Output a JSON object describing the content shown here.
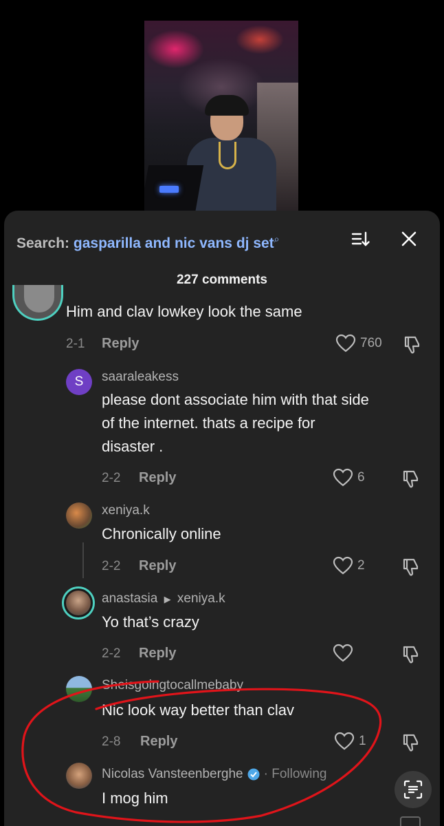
{
  "search": {
    "prefix": "Search:",
    "query": "gasparilla and nic vans dj set"
  },
  "comments_count": "227 comments",
  "comments": [
    {
      "text": "Him and clav lowkey look the same",
      "date": "2-1",
      "reply": "Reply",
      "likes": "760"
    },
    {
      "username": "saaraleakess",
      "avatar_letter": "S",
      "text_lines": [
        "please dont associate him with that side",
        "of the internet. thats a recipe for",
        "disaster ."
      ],
      "date": "2-2",
      "reply": "Reply",
      "likes": "6"
    },
    {
      "username": "xeniya.k",
      "text": "Chronically online",
      "date": "2-2",
      "reply": "Reply",
      "likes": "2"
    },
    {
      "username": "anastasia",
      "reply_to": "xeniya.k",
      "text": "Yo that’s crazy",
      "date": "2-2",
      "reply": "Reply",
      "likes": ""
    },
    {
      "username": "Sheisgoingtocallmebaby",
      "text": "Nic look way better than clav",
      "date": "2-8",
      "reply": "Reply",
      "likes": "1"
    },
    {
      "username": "Nicolas Vansteenberghe",
      "following": "· Following",
      "text": "I mog him"
    }
  ],
  "colors": {
    "panel_bg": "#232323",
    "query_blue": "#8fb8ff",
    "annotation_red": "#e0141a",
    "avatar_purple": "#6f3fc4"
  },
  "icons": [
    "search-icon",
    "sort-icon",
    "close-icon",
    "heart-icon",
    "dislike-icon",
    "verified-badge-icon",
    "caret-right-icon",
    "scan-text-icon"
  ]
}
